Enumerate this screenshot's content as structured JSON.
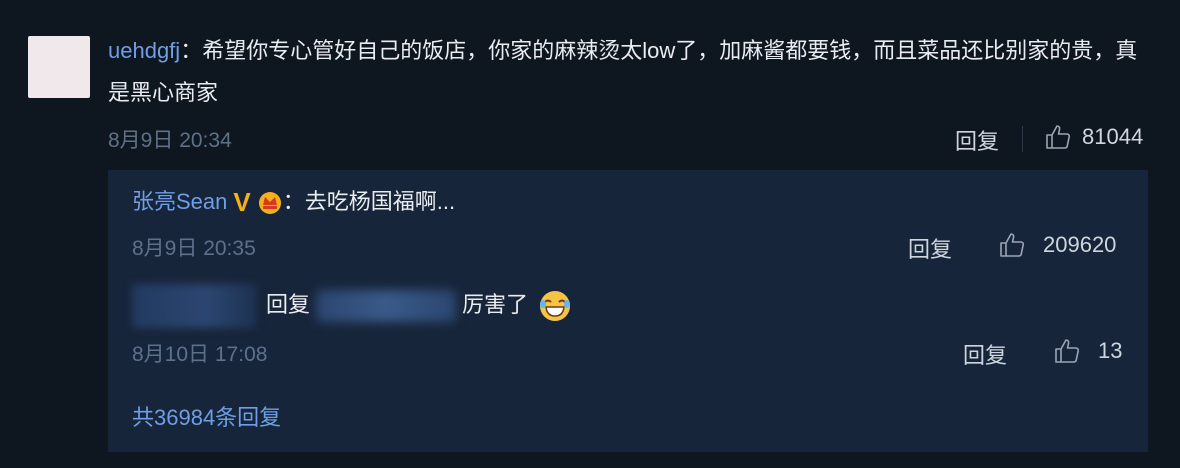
{
  "comment": {
    "username": "uehdgfj",
    "separator": "：",
    "text": "希望你专心管好自己的饭店，你家的麻辣烫太low了，加麻酱都要钱，而且菜品还比别家的贵，真是黑心商家",
    "time": "8月9日 20:34",
    "reply_label": "回复",
    "likes": "81044"
  },
  "reply": {
    "username": "张亮Sean",
    "separator": "：",
    "text": "去吃杨国福啊...",
    "time": "8月9日 20:35",
    "reply_label": "回复",
    "likes": "209620"
  },
  "sub_reply": {
    "prefix": "回复",
    "text": "厉害了",
    "time": "8月10日 17:08",
    "reply_label": "回复",
    "likes": "13"
  },
  "more_replies": "共36984条回复",
  "colors": {
    "background": "#0e1620",
    "reply_box": "#17253a",
    "link": "#6f9ee6",
    "muted": "#5e7187",
    "verified": "#f3b21a"
  }
}
